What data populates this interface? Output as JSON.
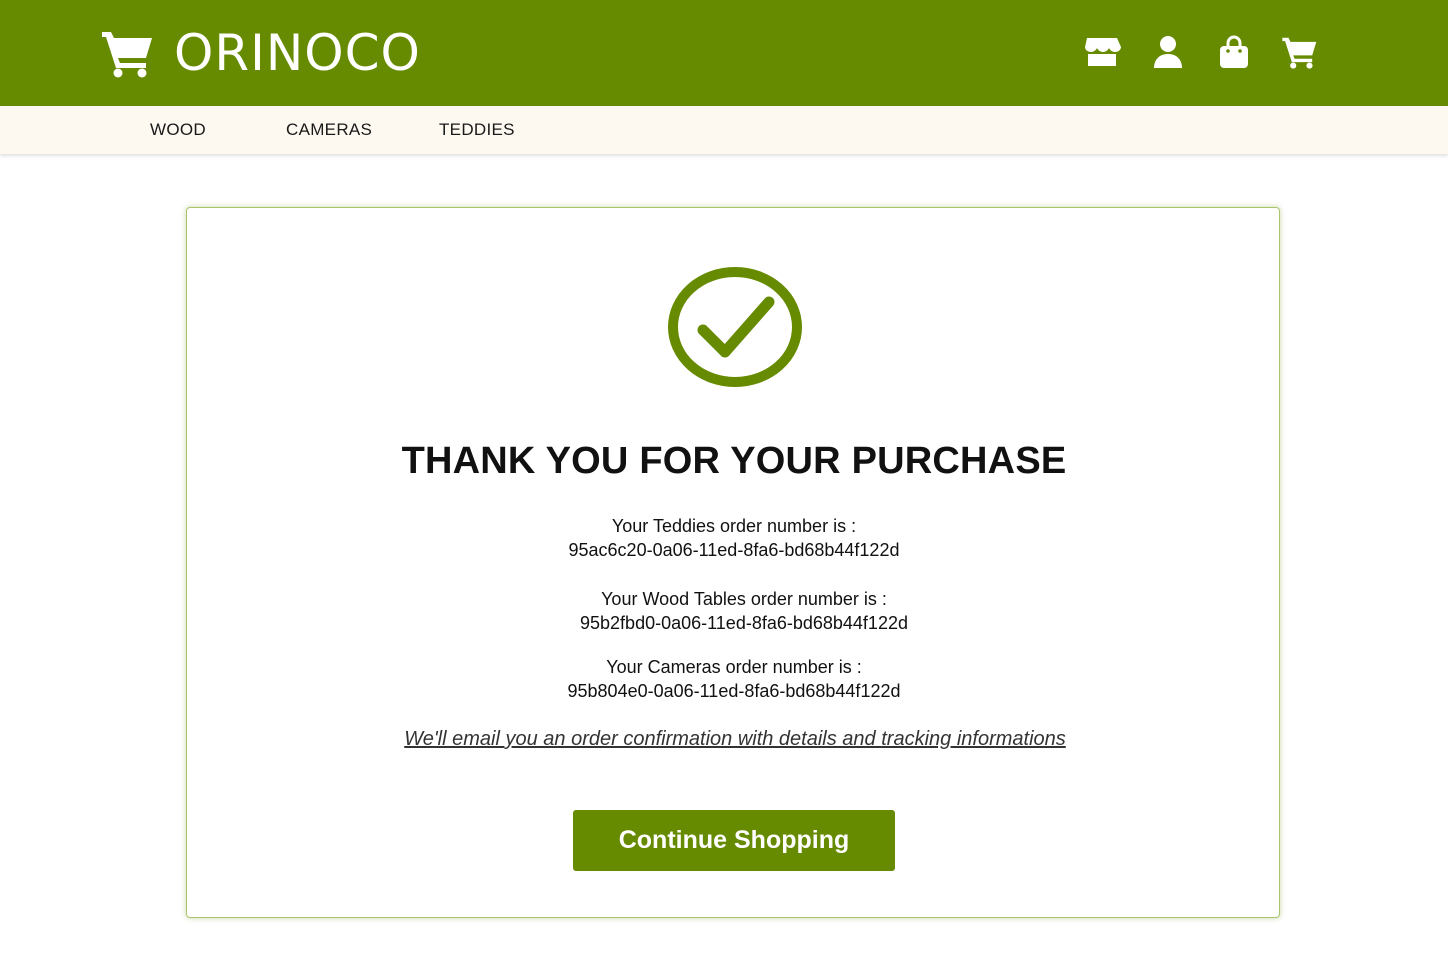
{
  "brand": {
    "name": "ORINOCO",
    "logo_icon": "shopping-cart-icon"
  },
  "header_icons": [
    {
      "name": "store-icon"
    },
    {
      "name": "user-icon"
    },
    {
      "name": "shopping-bag-icon"
    },
    {
      "name": "cart-icon"
    }
  ],
  "categories": [
    "WOOD",
    "CAMERAS",
    "TEDDIES"
  ],
  "confirmation": {
    "icon": "check-circle-icon",
    "title": "THANK YOU FOR YOUR PURCHASE",
    "orders": [
      {
        "label": "Your Teddies order number is :",
        "number": "95ac6c20-0a06-11ed-8fa6-bd68b44f122d"
      },
      {
        "label": "Your Wood Tables order number is :",
        "number": "95b2fbd0-0a06-11ed-8fa6-bd68b44f122d"
      },
      {
        "label": "Your Cameras order number is :",
        "number": "95b804e0-0a06-11ed-8fa6-bd68b44f122d"
      }
    ],
    "email_note": "We'll email you an order confirmation with details and tracking informations",
    "button_label": "Continue Shopping"
  },
  "colors": {
    "brand_green": "#668a00",
    "category_bar": "#fdf8f0",
    "white": "#ffffff"
  }
}
